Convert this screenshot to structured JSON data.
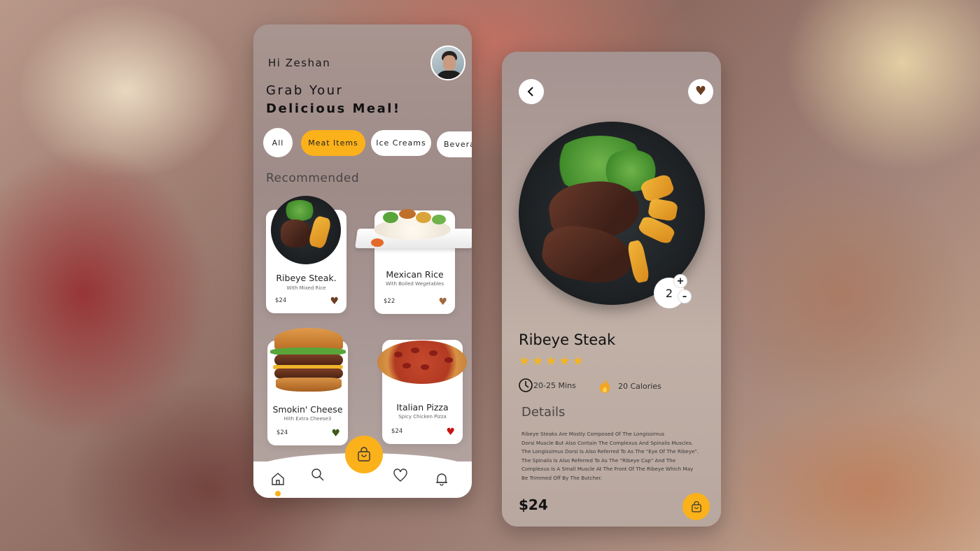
{
  "home": {
    "greeting": "Hi Zeshan",
    "headline_line1": "Grab Your",
    "headline_line2": "Delicious Meal!",
    "categories": [
      {
        "label": "All",
        "active": false
      },
      {
        "label": "Meat Items",
        "active": true
      },
      {
        "label": "Ice Creams",
        "active": false
      },
      {
        "label": "Beverages",
        "active": false
      }
    ],
    "section_title": "Recommended",
    "products": [
      {
        "name": "Ribeye Steak.",
        "subtitle": "With Mixed Rice",
        "price": "$24",
        "heart_color": "#6b3e22"
      },
      {
        "name": "Mexican Rice",
        "subtitle": "With Boiled Wegetables",
        "price": "$22",
        "heart_color": "#a06a3e"
      },
      {
        "name": "Smokin' Cheese",
        "subtitle": "Hith Extra Cheese3",
        "price": "$24",
        "heart_color": "#3f5a18"
      },
      {
        "name": "Italian Pizza",
        "subtitle": "Spicy Chicken Pizza",
        "price": "$24",
        "heart_color": "#c81414"
      }
    ],
    "nav": {
      "items": [
        "home-icon",
        "search-icon",
        "bag-icon",
        "heart-icon",
        "bell-icon"
      ],
      "active": "home-icon"
    }
  },
  "detail": {
    "title": "Ribeye Steak",
    "rating_stars": "★★★★★",
    "rating_value": 5,
    "quantity": "2",
    "plus": "+",
    "minus": "–",
    "time": "20-25 Mins",
    "calories": "20 Calories",
    "details_title": "Details",
    "description_lines": [
      "Ribeye Steaks Are Mostly Composed Of The Longissimus",
      "Dorsi Muscle But Also Contain The Complexus And Spinalis Muscles.",
      " The Longissimus Dorsi Is Also Referred To As The \"Eye Of The Ribeye\".",
      "The Spinalis Is Also Referred To As The \"Ribeye Cap\" And The",
      " Complexus Is A Small Muscle At The Front Of The Ribeye Which May",
      "Be Trimmed Off By The Butcher."
    ],
    "price": "$24"
  },
  "colors": {
    "accent": "#fbb11a",
    "star": "#f5b51c",
    "favorite": "#6b3e22"
  }
}
